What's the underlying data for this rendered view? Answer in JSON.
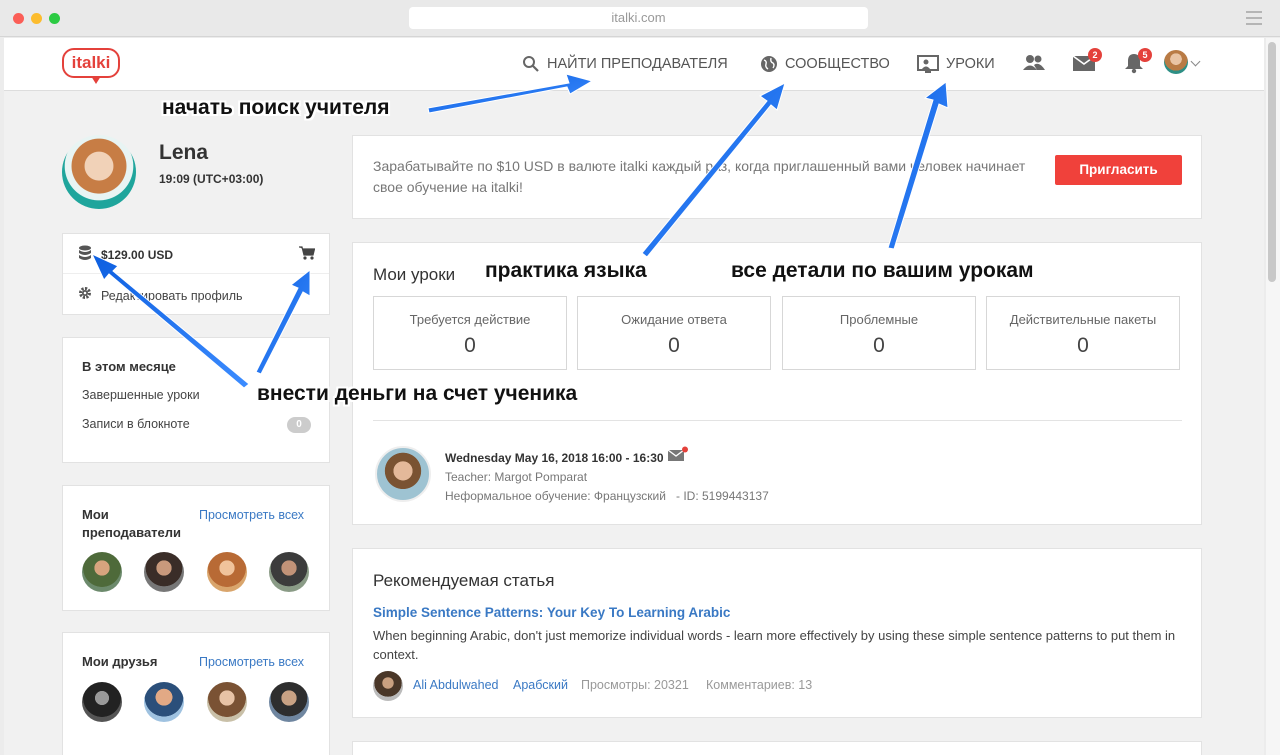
{
  "browser": {
    "url": "italki.com"
  },
  "header": {
    "logo": "italki",
    "nav": {
      "find_teacher": "НАЙТИ ПРЕПОДАВАТЕЛЯ",
      "community": "СООБЩЕСТВО",
      "lessons": "УРОКИ"
    },
    "messages_badge": "2",
    "notifications_badge": "5"
  },
  "profile": {
    "name": "Lena",
    "time": "19:09 (UTC+03:00)",
    "balance": "$129.00 USD",
    "edit_profile": "Редактировать профиль"
  },
  "month": {
    "title": "В этом месяце",
    "completed_lessons": "Завершенные уроки",
    "notebook": "Записи в блокноте",
    "notebook_count": "0"
  },
  "teachers": {
    "title": "Мои преподаватели",
    "see_all": "Просмотреть всех"
  },
  "friends": {
    "title": "Мои друзья",
    "see_all": "Просмотреть всех"
  },
  "invite": {
    "text": "Зарабатывайте по $10 USD в валюте italki каждый раз, когда приглашенный вами человек начинает свое обучение на italki!",
    "button": "Пригласить"
  },
  "lessons": {
    "title": "Мои уроки",
    "stats": [
      {
        "label": "Требуется действие",
        "value": "0"
      },
      {
        "label": "Ожидание ответа",
        "value": "0"
      },
      {
        "label": "Проблемные",
        "value": "0"
      },
      {
        "label": "Действительные пакеты",
        "value": "0"
      }
    ],
    "upcoming": {
      "date": "Wednesday May 16, 2018 16:00 - 16:30",
      "teacher": "Teacher: Margot Pomparat",
      "type": "Неформальное обучение: Французский",
      "id": "- ID: 5199443137"
    }
  },
  "article": {
    "title": "Рекомендуемая статья",
    "link": "Simple Sentence Patterns: Your Key To Learning Arabic",
    "desc": "When beginning Arabic, don't just memorize individual words - learn more effectively by using these simple sentence patterns to put them in context.",
    "author": "Ali Abdulwahed",
    "language": "Арабский",
    "views": "Просмотры: 20321",
    "comments": "Комментариев: 13"
  },
  "annotations": {
    "search": "начать поиск учителя",
    "practice": "практика языка",
    "details": "все детали по вашим урокам",
    "deposit": "внести деньги на счет ученика"
  },
  "colors": {
    "accent": "#f0413b",
    "link": "#3a79c4",
    "arrow": "#1f73f0"
  }
}
